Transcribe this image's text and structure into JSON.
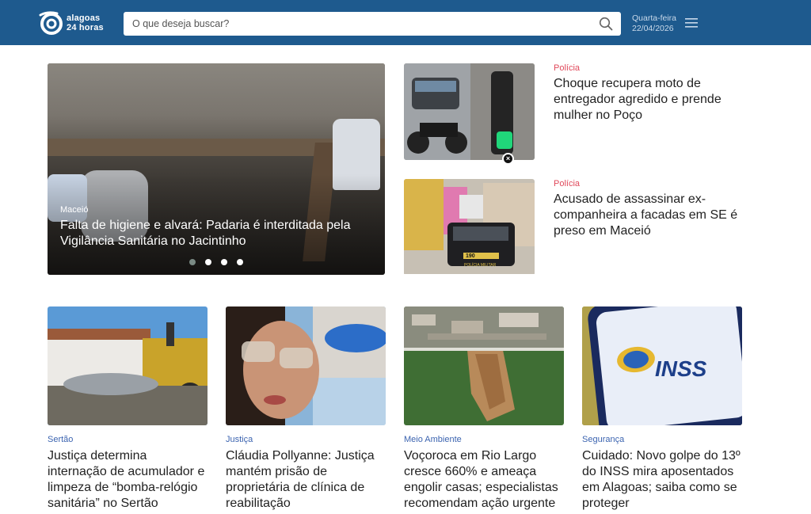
{
  "header": {
    "logo_line1": "alagoas",
    "logo_line2": "24 horas",
    "search_placeholder": "O que deseja buscar?",
    "weekday": "Quarta-feira",
    "date": "22/04/2026"
  },
  "hero": {
    "category": "Maceió",
    "title": "Falta de higiene e alvará: Padaria é interditada pela Vigilância Sanitária no Jacintinho",
    "dots": 4,
    "active_dot": 1
  },
  "side_news": [
    {
      "category": "Polícia",
      "title": "Choque recupera moto de entregador agredido e prende mulher no Poço"
    },
    {
      "category": "Polícia",
      "title": "Acusado de assassinar ex-companheira a facadas em SE é preso em Maceió"
    }
  ],
  "cards": [
    {
      "category": "Sertão",
      "title": "Justiça determina internação de acumulador e limpeza de “bomba-relógio sanitária” no Sertão"
    },
    {
      "category": "Justiça",
      "title": "Cláudia Pollyanne: Justiça mantém prisão de proprietária de clínica de reabilitação"
    },
    {
      "category": "Meio Ambiente",
      "title": "Voçoroca em Rio Largo cresce 660% e ameaça engolir casas; especialistas recomendam ação urgente"
    },
    {
      "category": "Segurança",
      "title": "Cuidado: Novo golpe do 13º do INSS mira aposentados em Alagoas; saiba como se proteger"
    }
  ],
  "image_texts": {
    "police_car_number": "190",
    "police_car_label": "POLÍCIA MILITAR",
    "inss_logo": "INSS"
  },
  "colors": {
    "header_bg": "#1e5a8e",
    "police_category": "#e0485a",
    "card_category": "#3c64b0"
  }
}
